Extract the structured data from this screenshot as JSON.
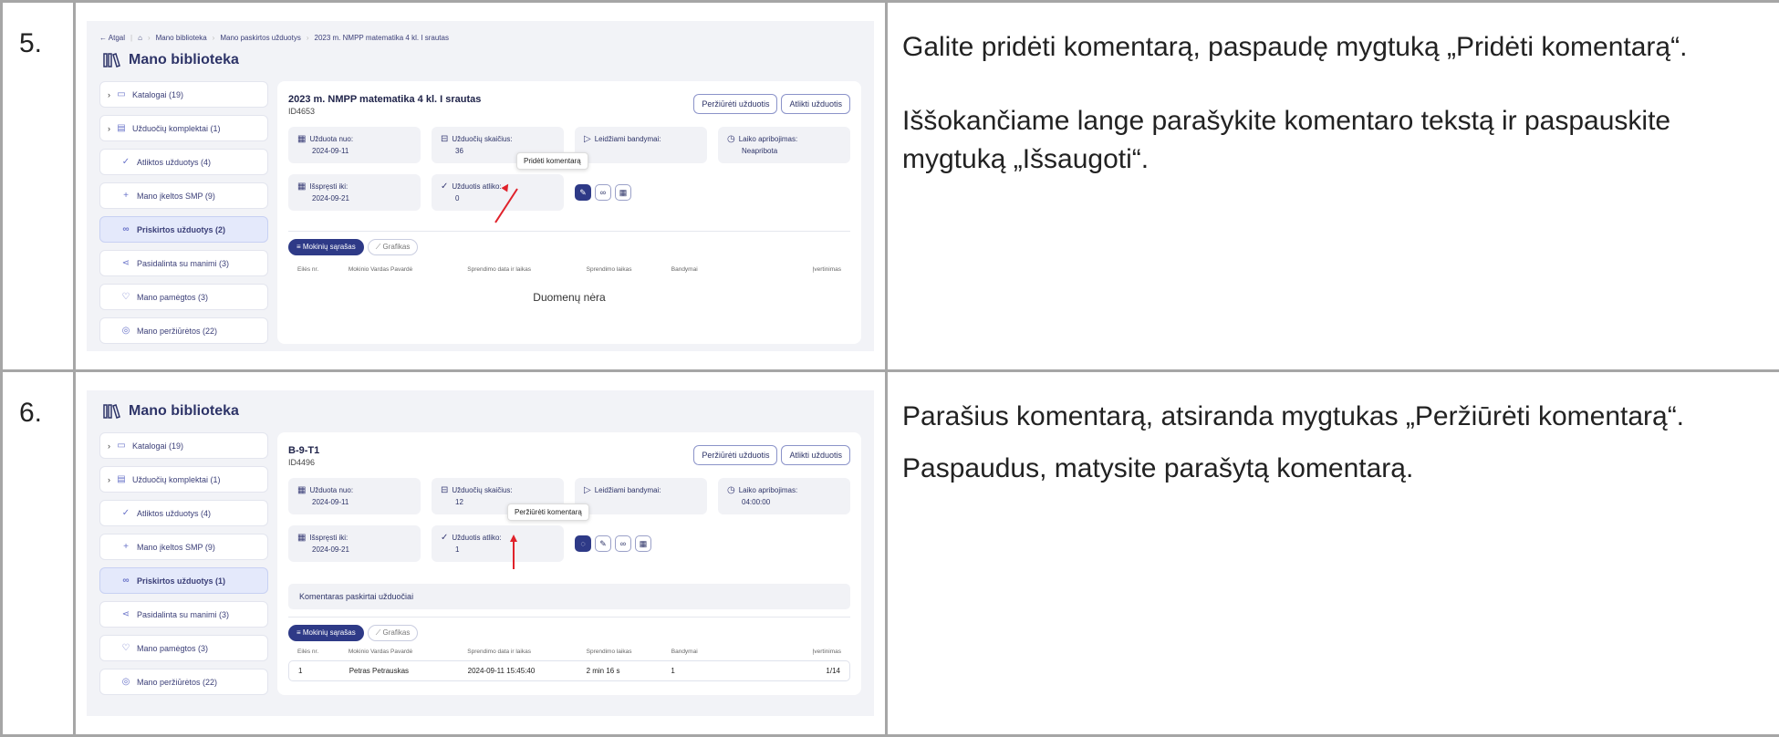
{
  "rows": [
    {
      "number": "5.",
      "text": [
        "Galite pridėti komentarą, paspaudę mygtuką „Pridėti komentarą“.",
        "Iššokančiame lange parašykite komentaro tekstą ir paspauskite mygtuką „Išsaugoti“."
      ],
      "screen": {
        "breadcrumb": {
          "back": "← Atgal",
          "home": "⌂",
          "items": [
            "Mano biblioteka",
            "Mano paskirtos užduotys",
            "2023 m. NMPP matematika 4 kl. I srautas"
          ]
        },
        "lib_title": "Mano biblioteka",
        "sidebar": [
          {
            "label": "Katalogai (19)",
            "icon": "folder-icon",
            "chevron": true
          },
          {
            "label": "Užduočių komplektai (1)",
            "icon": "grid-icon",
            "chevron": true
          },
          {
            "label": "Atliktos užduotys (4)",
            "icon": "check-circle-icon"
          },
          {
            "label": "Mano įkeltos SMP (9)",
            "icon": "plus-icon"
          },
          {
            "label": "Priskirtos užduotys (2)",
            "icon": "link-icon",
            "active": true
          },
          {
            "label": "Pasidalinta su manimi (3)",
            "icon": "share-icon"
          },
          {
            "label": "Mano pamėgtos (3)",
            "icon": "heart-icon"
          },
          {
            "label": "Mano peržiūrėtos (22)",
            "icon": "eye-icon"
          }
        ],
        "task_title": "2023 m. NMPP matematika 4 kl. I srautas",
        "task_id": "ID4653",
        "btn_view": "Peržiūrėti užduotis",
        "btn_do": "Atlikti užduotis",
        "cards": [
          {
            "label": "Užduota nuo:",
            "value": "2024-09-11"
          },
          {
            "label": "Užduočių skaičius:",
            "value": "36"
          },
          {
            "label": "Leidžiami bandymai:",
            "value": ""
          },
          {
            "label": "Laiko apribojimas:",
            "value": "Neapribota"
          },
          {
            "label": "Išspręsti iki:",
            "value": "2024-09-21"
          },
          {
            "label": "Užduotis atliko:",
            "value": "0"
          }
        ],
        "tooltip": "Pridėti komentarą",
        "tabs": [
          "Mokinių sąrašas",
          "Grafikas"
        ],
        "columns": [
          "Eilės nr.",
          "Mokinio Vardas Pavardė",
          "Sprendimo data ir laikas",
          "Sprendimo laikas",
          "Bandymai",
          "Įvertinimas"
        ],
        "empty": "Duomenų nėra"
      }
    },
    {
      "number": "6.",
      "text": [
        "Parašius komentarą, atsiranda mygtukas „Peržiūrėti komentarą“.",
        "Paspaudus, matysite parašytą komentarą."
      ],
      "screen": {
        "lib_title": "Mano biblioteka",
        "sidebar": [
          {
            "label": "Katalogai (19)",
            "icon": "folder-icon",
            "chevron": true
          },
          {
            "label": "Užduočių komplektai (1)",
            "icon": "grid-icon",
            "chevron": true
          },
          {
            "label": "Atliktos užduotys (4)",
            "icon": "check-circle-icon"
          },
          {
            "label": "Mano įkeltos SMP (9)",
            "icon": "plus-icon"
          },
          {
            "label": "Priskirtos užduotys (1)",
            "icon": "link-icon",
            "active": true
          },
          {
            "label": "Pasidalinta su manimi (3)",
            "icon": "share-icon"
          },
          {
            "label": "Mano pamėgtos (3)",
            "icon": "heart-icon"
          },
          {
            "label": "Mano peržiūrėtos (22)",
            "icon": "eye-icon"
          }
        ],
        "task_title": "B-9-T1",
        "task_id": "ID4496",
        "btn_view": "Peržiūrėti užduotis",
        "btn_do": "Atlikti užduotis",
        "cards": [
          {
            "label": "Užduota nuo:",
            "value": "2024-09-11"
          },
          {
            "label": "Užduočių skaičius:",
            "value": "12"
          },
          {
            "label": "Leidžiami bandymai:",
            "value": ""
          },
          {
            "label": "Laiko apribojimas:",
            "value": "04:00:00"
          },
          {
            "label": "Išspręsti iki:",
            "value": "2024-09-21"
          },
          {
            "label": "Užduotis atliko:",
            "value": "1"
          }
        ],
        "tooltip": "Peržiūrėti komentarą",
        "comment": "Komentaras paskirtai užduočiai",
        "tabs": [
          "Mokinių sąrašas",
          "Grafikas"
        ],
        "columns": [
          "Eilės nr.",
          "Mokinio Vardas Pavardė",
          "Sprendimo data ir laikas",
          "Sprendimo laikas",
          "Bandymai",
          "Įvertinimas"
        ],
        "table_rows": [
          [
            "1",
            "Petras Petrauskas",
            "2024-09-11 15:45:40",
            "2 min 16 s",
            "1",
            "1/14"
          ]
        ]
      }
    }
  ]
}
